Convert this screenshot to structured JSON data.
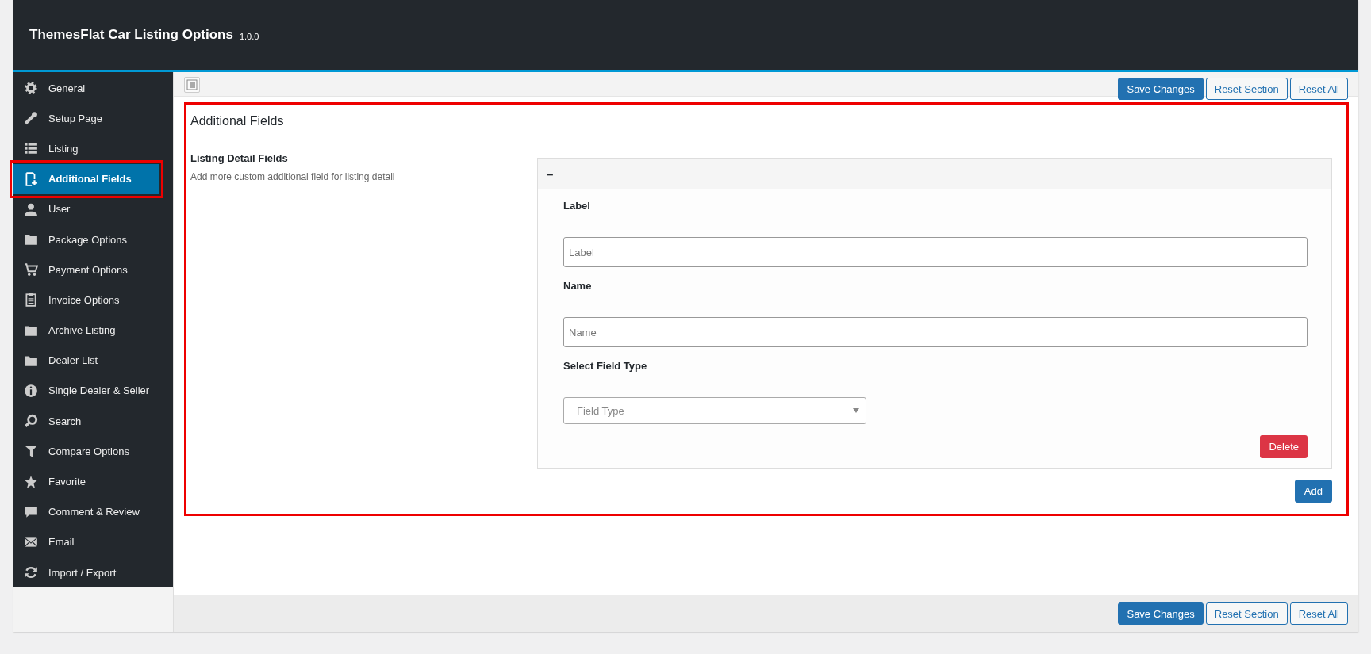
{
  "header": {
    "title": "ThemesFlat Car Listing Options",
    "version": "1.0.0"
  },
  "sidebar": {
    "items": [
      {
        "label": "General",
        "selected": false
      },
      {
        "label": "Setup Page",
        "selected": false
      },
      {
        "label": "Listing",
        "selected": false
      },
      {
        "label": "Additional Fields",
        "selected": true
      },
      {
        "label": "User",
        "selected": false
      },
      {
        "label": "Package Options",
        "selected": false
      },
      {
        "label": "Payment Options",
        "selected": false
      },
      {
        "label": "Invoice Options",
        "selected": false
      },
      {
        "label": "Archive Listing",
        "selected": false
      },
      {
        "label": "Dealer List",
        "selected": false
      },
      {
        "label": "Single Dealer & Seller",
        "selected": false
      },
      {
        "label": "Search",
        "selected": false
      },
      {
        "label": "Compare Options",
        "selected": false
      },
      {
        "label": "Favorite",
        "selected": false
      },
      {
        "label": "Comment & Review",
        "selected": false
      },
      {
        "label": "Email",
        "selected": false
      },
      {
        "label": "Import / Export",
        "selected": false
      }
    ]
  },
  "toolbar": {
    "buttons": [
      {
        "label": "Save Changes",
        "kind": "primary"
      },
      {
        "label": "Reset Section",
        "kind": "secondary"
      },
      {
        "label": "Reset All",
        "kind": "secondary"
      }
    ]
  },
  "section": {
    "title": "Additional Fields",
    "field_title": "Listing Detail Fields",
    "field_description": "Add more custom additional field for listing detail",
    "repeater": {
      "toggle": "–",
      "fields": [
        {
          "kind": "text",
          "label": "Label",
          "placeholder": "Label"
        },
        {
          "kind": "text",
          "label": "Name",
          "placeholder": "Name"
        },
        {
          "kind": "select",
          "label": "Select Field Type",
          "placeholder": "Field Type"
        }
      ],
      "delete": "Delete"
    },
    "add": "Add"
  },
  "footer": {
    "buttons": [
      {
        "label": "Save Changes",
        "kind": "primary"
      },
      {
        "label": "Reset Section",
        "kind": "secondary"
      },
      {
        "label": "Reset All",
        "kind": "secondary"
      }
    ]
  }
}
